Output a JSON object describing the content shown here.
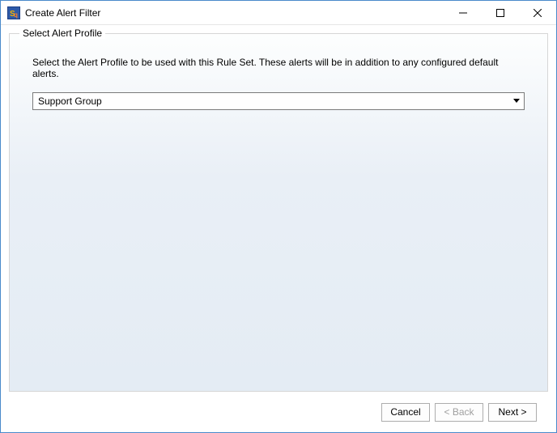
{
  "window": {
    "title": "Create Alert Filter"
  },
  "section": {
    "legend": "Select Alert Profile",
    "instruction": "Select the Alert Profile to be used with this Rule Set. These alerts will be in addition to any configured default alerts."
  },
  "profile_select": {
    "selected": "Support Group"
  },
  "buttons": {
    "cancel": "Cancel",
    "back": "< Back",
    "next": "Next >"
  }
}
